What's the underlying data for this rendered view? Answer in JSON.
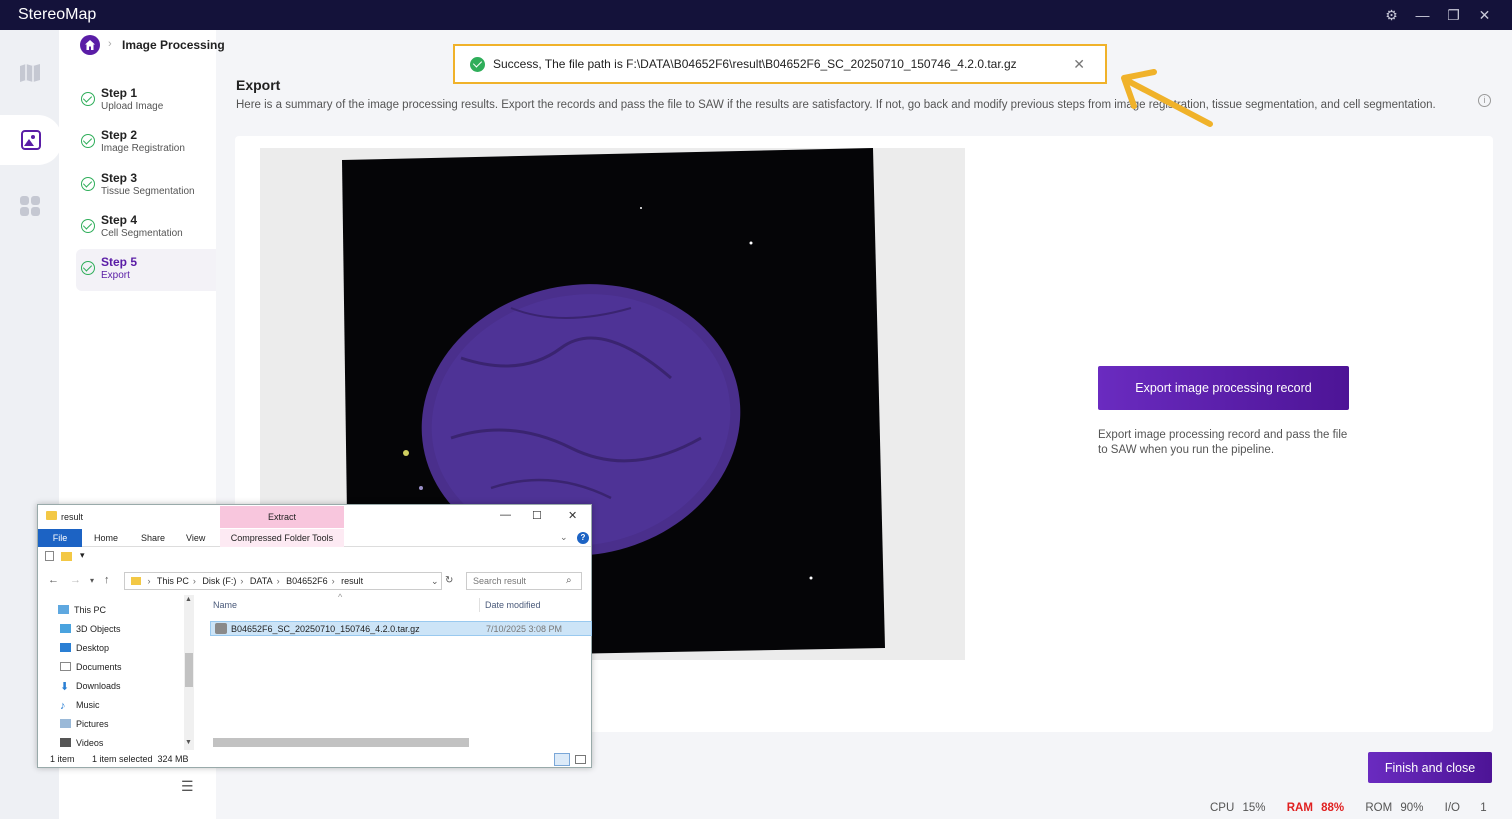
{
  "app": {
    "title": "StereoMap"
  },
  "breadcrumb": {
    "title": "Image Processing",
    "separator": "›"
  },
  "window_controls": {
    "settings": "⚙",
    "minimize": "—",
    "restore": "❐",
    "close": "✕"
  },
  "steps": [
    {
      "name": "Step 1",
      "label": "Upload Image",
      "state": "done"
    },
    {
      "name": "Step 2",
      "label": "Image Registration",
      "state": "done"
    },
    {
      "name": "Step 3",
      "label": "Tissue Segmentation",
      "state": "done"
    },
    {
      "name": "Step 4",
      "label": "Cell Segmentation",
      "state": "done"
    },
    {
      "name": "Step 5",
      "label": "Export",
      "state": "active"
    }
  ],
  "export": {
    "title": "Export",
    "description": "Here is a summary of the image processing results. Export the records and pass the file to SAW if the results are satisfactory. If not, go back and modify previous steps from image registration, tissue segmentation, and cell segmentation.",
    "button": "Export image processing record",
    "note": "Export image processing record and pass the file to SAW when you run the pipeline."
  },
  "toast": {
    "message": "Success, The file path is F:\\DATA\\B04652F6\\result\\B04652F6_SC_20250710_150746_4.2.0.tar.gz"
  },
  "footer": {
    "finish_button": "Finish and close"
  },
  "status": {
    "cpu_label": "CPU",
    "cpu_value": "15%",
    "ram_label": "RAM",
    "ram_value": "88%",
    "rom_label": "ROM",
    "rom_value": "90%",
    "io_label": "I/O",
    "io_value": "1"
  },
  "explorer": {
    "title": "result",
    "extract_tab": "Extract",
    "ribbon_tabs": [
      "File",
      "Home",
      "Share",
      "View"
    ],
    "compressed_tools": "Compressed Folder Tools",
    "address": [
      "This PC",
      "Disk (F:)",
      "DATA",
      "B04652F6",
      "result"
    ],
    "search_placeholder": "Search result",
    "tree": [
      "This PC",
      "3D Objects",
      "Desktop",
      "Documents",
      "Downloads",
      "Music",
      "Pictures",
      "Videos"
    ],
    "columns": {
      "name": "Name",
      "date": "Date modified"
    },
    "file": {
      "name": "B04652F6_SC_20250710_150746_4.2.0.tar.gz",
      "date": "7/10/2025 3:08 PM"
    },
    "status_items": "1 item",
    "status_selected": "1 item selected  324 MB"
  },
  "colors": {
    "accent": "#5a1da6",
    "titlebar": "#14123a",
    "success": "#2fae5a",
    "highlight": "#f0b22a",
    "warning": "#e02020"
  }
}
